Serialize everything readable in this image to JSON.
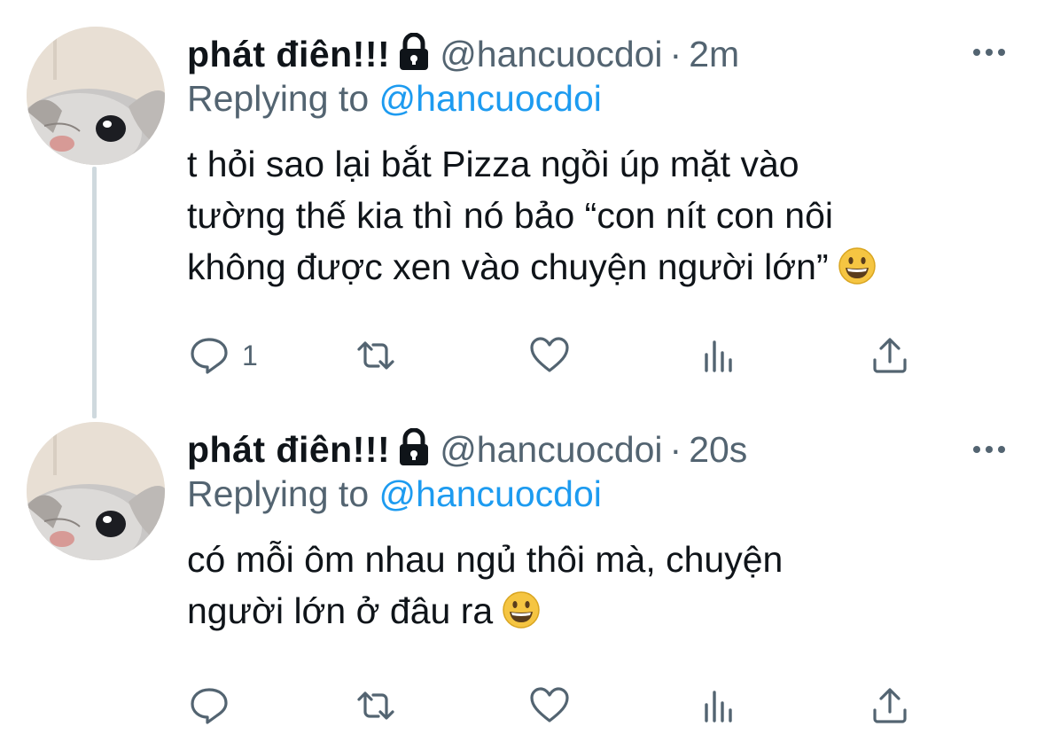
{
  "tweets": [
    {
      "name": "phát điên!!!",
      "handle": "@hancuocdoi",
      "separator": "·",
      "time": "2m",
      "replying_label": "Replying to",
      "replying_handle": "@hancuocdoi",
      "text_lines": [
        "t hỏi sao lại bắt Pizza ngồi úp mặt vào",
        "tường thế kia thì nó bảo “con nít con nôi",
        "không được xen vào chuyện người lớn”"
      ],
      "emoji": "grinning-face",
      "reply_count": "1"
    },
    {
      "name": "phát điên!!!",
      "handle": "@hancuocdoi",
      "separator": "·",
      "time": "20s",
      "replying_label": "Replying to",
      "replying_handle": "@hancuocdoi",
      "text_lines": [
        "có mỗi ôm nhau ngủ thôi mà, chuyện",
        "người lớn ở đâu ra"
      ],
      "emoji": "grinning-face",
      "reply_count": ""
    }
  ],
  "icons": {
    "lock": "lock-icon",
    "more": "more-icon",
    "reply": "reply-icon",
    "retweet": "retweet-icon",
    "like": "heart-icon",
    "views": "views-icon",
    "share": "share-icon"
  },
  "colors": {
    "text": "#0f1419",
    "secondary": "#536471",
    "link": "#1d9bf0",
    "thread_line": "#cfd9de"
  }
}
